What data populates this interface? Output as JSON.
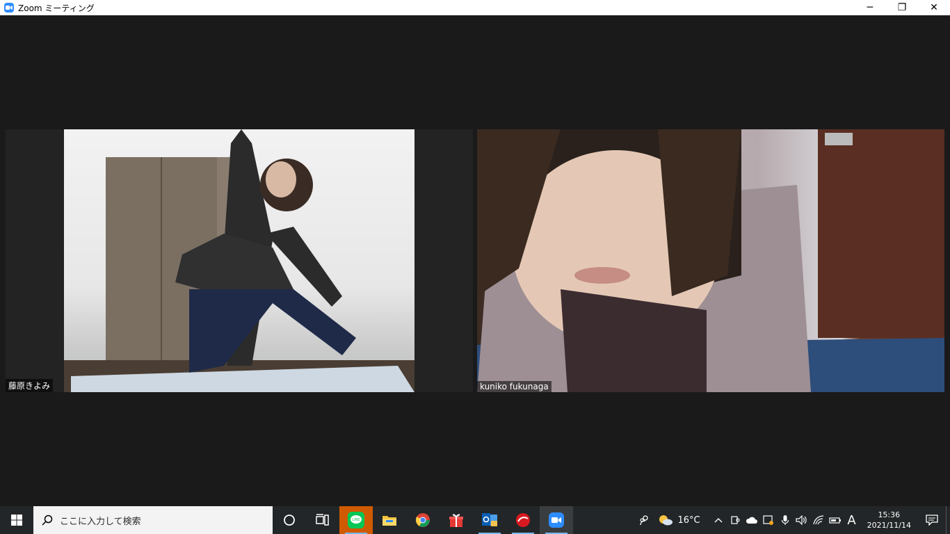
{
  "window": {
    "title": "Zoom ミーティング",
    "minimize": "─",
    "restore": "❐",
    "close": "✕"
  },
  "participants": [
    {
      "name": "藤原きよみ"
    },
    {
      "name": "kuniko fukunaga"
    }
  ],
  "taskbar": {
    "search_placeholder": "ここに入力して検索",
    "pinned_apps": [
      "cortana",
      "task-view",
      "line",
      "file-explorer",
      "chrome",
      "gift",
      "outlook",
      "trend-micro",
      "zoom"
    ],
    "weather_temp": "16°C",
    "ime_mode": "A",
    "time": "15:36",
    "date": "2021/11/14"
  },
  "colors": {
    "zoom_blue": "#2d8cff",
    "taskbar_bg": "#232628",
    "meeting_bg": "#1a1a1a",
    "line_green": "#06c755"
  }
}
